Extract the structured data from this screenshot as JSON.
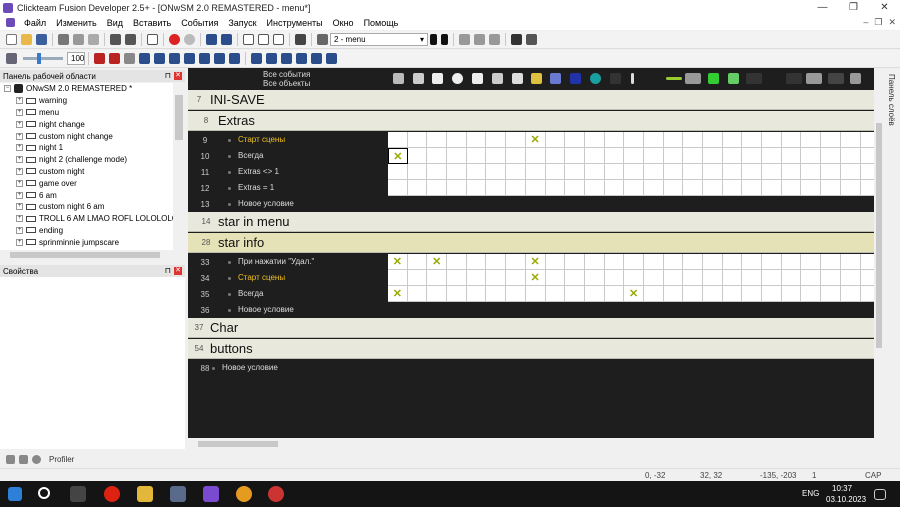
{
  "window": {
    "title": "Clickteam Fusion Developer 2.5+ - [ONwSM 2.0 REMASTERED - menu*]"
  },
  "menubar": {
    "items": [
      "Файл",
      "Изменить",
      "Вид",
      "Вставить",
      "События",
      "Запуск",
      "Инструменты",
      "Окно",
      "Помощь"
    ]
  },
  "toolbar": {
    "frame_combo": "2 - menu",
    "zoom_value": "100"
  },
  "workspace": {
    "title": "Панель рабочей области",
    "root": "ONwSM 2.0 REMASTERED *",
    "frames": [
      "warning",
      "menu",
      "night change",
      "custom night change",
      "night 1",
      "night 2 (challenge mode)",
      "custom night",
      "game over",
      "6 am",
      "custom night 6 am",
      "TROLL 6 AM LMAO ROFL LOLOLOLOL",
      "ending",
      "sprinminnie jumpscare"
    ]
  },
  "properties": {
    "title": "Свойства"
  },
  "right_panel": {
    "label": "Панель слоёв"
  },
  "editor": {
    "header": {
      "all_events": "Все события",
      "all_objects": "Все объекты"
    },
    "rows": [
      {
        "kind": "group",
        "num": "7",
        "name": "INI-SAVE",
        "level": 0
      },
      {
        "kind": "group",
        "num": "8",
        "name": "Extras",
        "level": 1
      },
      {
        "kind": "cond",
        "num": "9",
        "text": "Старт сцены",
        "start": true,
        "checks": [
          7
        ]
      },
      {
        "kind": "cond",
        "num": "10",
        "text": "Всегда",
        "start": false,
        "checks": [
          0
        ]
      },
      {
        "kind": "cond",
        "num": "11",
        "text": "Extras <> 1",
        "start": false,
        "checks": []
      },
      {
        "kind": "cond",
        "num": "12",
        "text": "Extras = 1",
        "start": false,
        "checks": []
      },
      {
        "kind": "new",
        "num": "13",
        "text": "Новое условие"
      },
      {
        "kind": "group",
        "num": "14",
        "name": "star in menu",
        "level": 1
      },
      {
        "kind": "group",
        "num": "28",
        "name": "star info",
        "level": 1,
        "highlight": true
      },
      {
        "kind": "cond",
        "num": "33",
        "text": "При нажатии \"Удал.\"",
        "start": false,
        "checks": [
          0,
          2,
          7
        ]
      },
      {
        "kind": "cond",
        "num": "34",
        "text": "Старт сцены",
        "start": true,
        "checks": [
          7
        ]
      },
      {
        "kind": "cond",
        "num": "35",
        "text": "Всегда",
        "start": false,
        "checks": [
          0,
          12
        ]
      },
      {
        "kind": "new",
        "num": "36",
        "text": "Новое условие"
      },
      {
        "kind": "group",
        "num": "37",
        "name": "Char",
        "level": 0
      },
      {
        "kind": "group",
        "num": "54",
        "name": "buttons",
        "level": 0
      },
      {
        "kind": "new",
        "num": "88",
        "text": "Новое условие",
        "wide": true
      }
    ]
  },
  "bottom_tabs": {
    "profiler": "Profiler"
  },
  "statusbar": {
    "coord1": "0, -32",
    "coord2": "32, 32",
    "coord3": "-135, -203",
    "count": "1",
    "caps": "CAP NUM"
  },
  "taskbar": {
    "lang": "ENG",
    "time": "10:37",
    "date": "03.10.2023"
  }
}
